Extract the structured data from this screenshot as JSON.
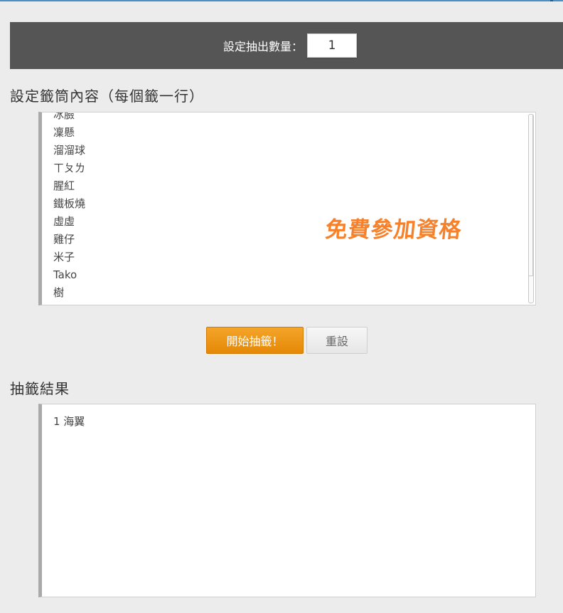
{
  "settings": {
    "count_label": "設定抽出數量：",
    "count_value": "1"
  },
  "list_section": {
    "title": "設定籤筒內容（每個籤一行）",
    "entries": [
      "冰臉",
      "凜懸",
      "溜溜球",
      "ㄒㄆㄌ",
      "腥紅",
      "鐵板燒",
      "虛虛",
      "雞仔",
      "米子",
      "Tako",
      "樹"
    ]
  },
  "watermark": "免費參加資格",
  "buttons": {
    "start_label": "開始抽籤！",
    "reset_label": "重設"
  },
  "result_section": {
    "title": "抽籤結果",
    "result_text": "1 海翼"
  },
  "colors": {
    "header_bar": "#555555",
    "start_button": "#ef9612",
    "watermark": "#f7812b",
    "page_background": "#ececec"
  }
}
